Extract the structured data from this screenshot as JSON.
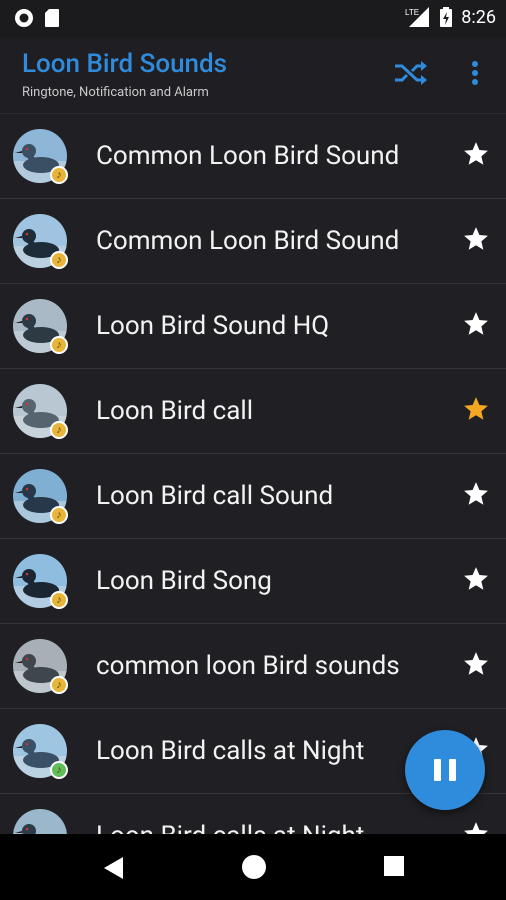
{
  "status_bar": {
    "time": "8:26",
    "network": "LTE"
  },
  "app_bar": {
    "title": "Loon Bird Sounds",
    "subtitle": "Ringtone, Notification and Alarm",
    "accent_color": "#2f8bdc"
  },
  "sounds": [
    {
      "title": "Common Loon Bird Sound",
      "favorite": false,
      "badge_color": "#e7b53a"
    },
    {
      "title": "Common Loon Bird Sound",
      "favorite": false,
      "badge_color": "#e7b53a"
    },
    {
      "title": "Loon Bird Sound HQ",
      "favorite": false,
      "badge_color": "#e7b53a"
    },
    {
      "title": "Loon Bird call",
      "favorite": true,
      "badge_color": "#e7b53a"
    },
    {
      "title": "Loon Bird call Sound",
      "favorite": false,
      "badge_color": "#e7b53a"
    },
    {
      "title": "Loon Bird Song",
      "favorite": false,
      "badge_color": "#e7b53a"
    },
    {
      "title": "common loon Bird sounds",
      "favorite": false,
      "badge_color": "#e7b53a"
    },
    {
      "title": "Loon Bird calls at Night",
      "favorite": false,
      "badge_color": "#5fbf5a"
    },
    {
      "title": "Loon Bird calls at Night",
      "favorite": false,
      "badge_color": "#e7b53a"
    }
  ],
  "fab": {
    "icon": "pause-icon",
    "color": "#2f8bdc"
  },
  "icons": {
    "shuffle": "shuffle-icon",
    "overflow": "more-vert-icon",
    "star": "star-icon",
    "music_badge": "music-note-icon"
  },
  "colors": {
    "favorite_star": "#f5a623",
    "star": "#ffffff",
    "background": "#202024"
  }
}
